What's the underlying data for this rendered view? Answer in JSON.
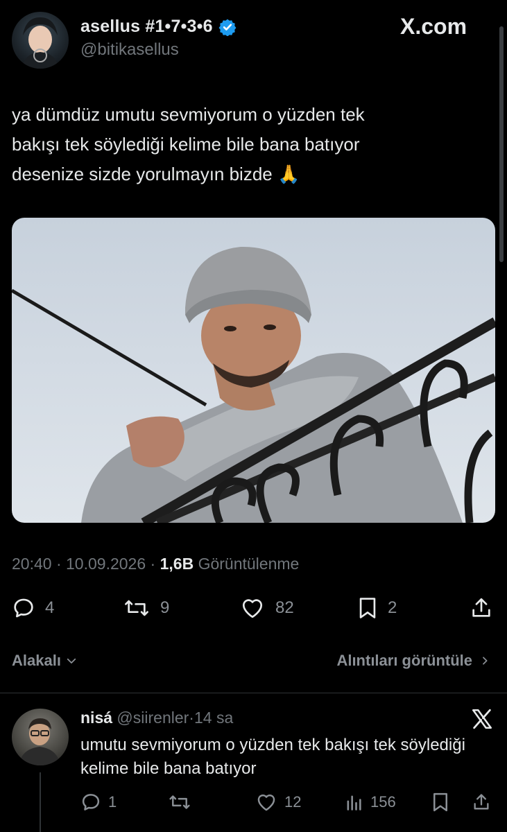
{
  "post": {
    "display_name": "asellus #1•7•3•6",
    "handle": "@bitikasellus",
    "site_logo": "X.com",
    "text": "ya dümdüz umutu sevmiyorum o yüzden tek\nbakışı tek söylediği kelime bile bana batıyor\ndesenize sizde yorulmayın bizde 🙏",
    "verified": true,
    "verified_color": "#1d9bf0",
    "time": "20:40",
    "date": "10.09.2026",
    "views_count": "1,6B",
    "views_label": "Görüntülenme",
    "stats": {
      "replies": "4",
      "reposts": "9",
      "likes": "82",
      "bookmarks": "2"
    }
  },
  "sort": {
    "label": "Alakalı"
  },
  "quotes_link": "Alıntıları görüntüle",
  "reply": {
    "name": "nisá",
    "handle": "@siirenler",
    "separator": "·",
    "time_ago": "14 sa",
    "text": "umutu sevmiyorum o yüzden tek bakışı tek söylediği kelime bile bana batıyor",
    "stats": {
      "replies": "1",
      "likes": "12",
      "views": "156"
    }
  },
  "icons": [
    "verified-badge-icon",
    "reply-icon",
    "repost-icon",
    "like-icon",
    "bookmark-icon",
    "share-icon",
    "chevron-down-icon",
    "chevron-right-icon",
    "x-logo-icon",
    "views-icon"
  ],
  "colors": {
    "background": "#000000",
    "text": "#e7e9ea",
    "secondary": "#71767b",
    "divider": "#2f3336",
    "accent": "#1d9bf0"
  }
}
